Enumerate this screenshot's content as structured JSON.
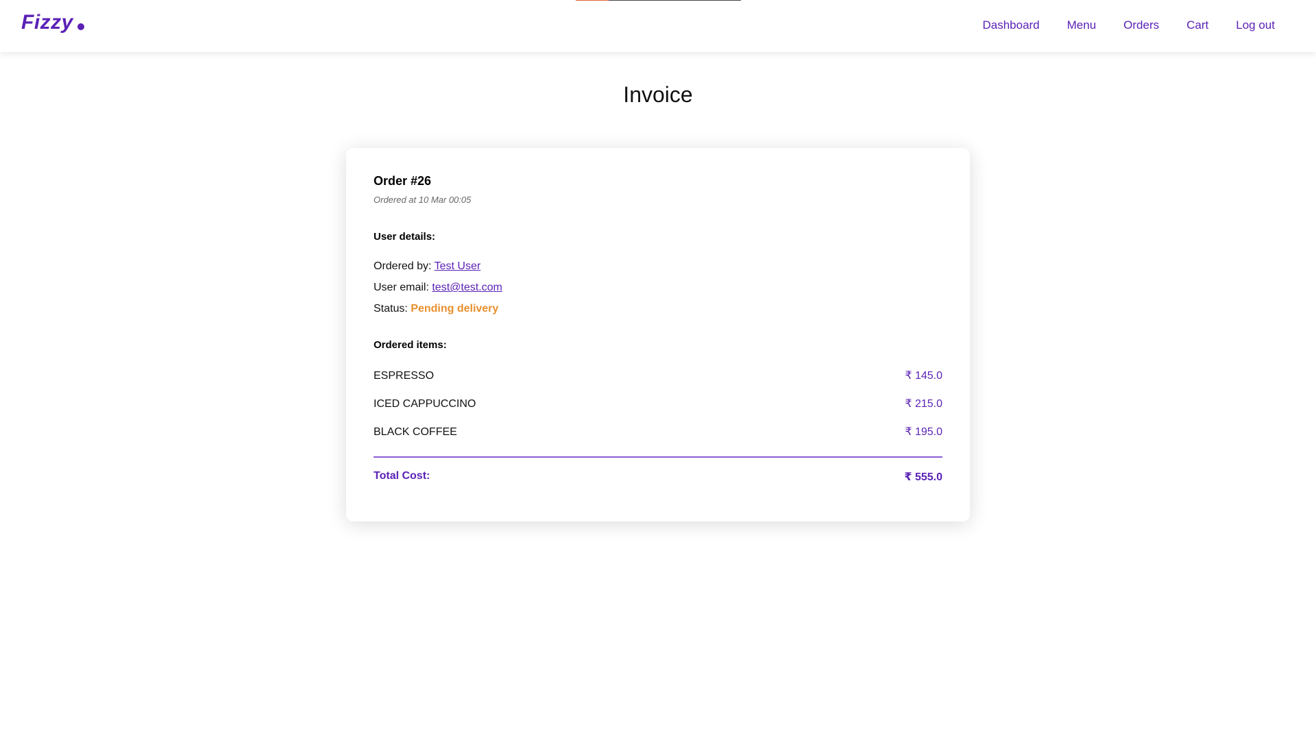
{
  "loading_progress": 0.2,
  "nav": {
    "brand": "Fizzy",
    "links": [
      "Dashboard",
      "Menu",
      "Orders",
      "Cart",
      "Log out"
    ]
  },
  "page": {
    "title": "Invoice"
  },
  "order": {
    "title": "Order #26",
    "ordered_at": "Ordered at 10 Mar 00:05",
    "user_details_heading": "User details:",
    "ordered_by_label": "Ordered by:",
    "ordered_by_value": "Test User",
    "email_label": "User email:",
    "email_value": "test@test.com",
    "status_label": "Status:",
    "status_value": "Pending delivery",
    "items_heading": "Ordered items:",
    "items": [
      {
        "name": "ESPRESSO",
        "price": "₹ 145.0"
      },
      {
        "name": "ICED CAPPUCCINO",
        "price": "₹ 215.0"
      },
      {
        "name": "BLACK COFFEE",
        "price": "₹ 195.0"
      }
    ],
    "total_label": "Total Cost:",
    "total_value": "₹ 555.0"
  },
  "colors": {
    "accent": "#5b21b6",
    "status_pending": "#e8902e",
    "progress_done": "#e0603a"
  }
}
